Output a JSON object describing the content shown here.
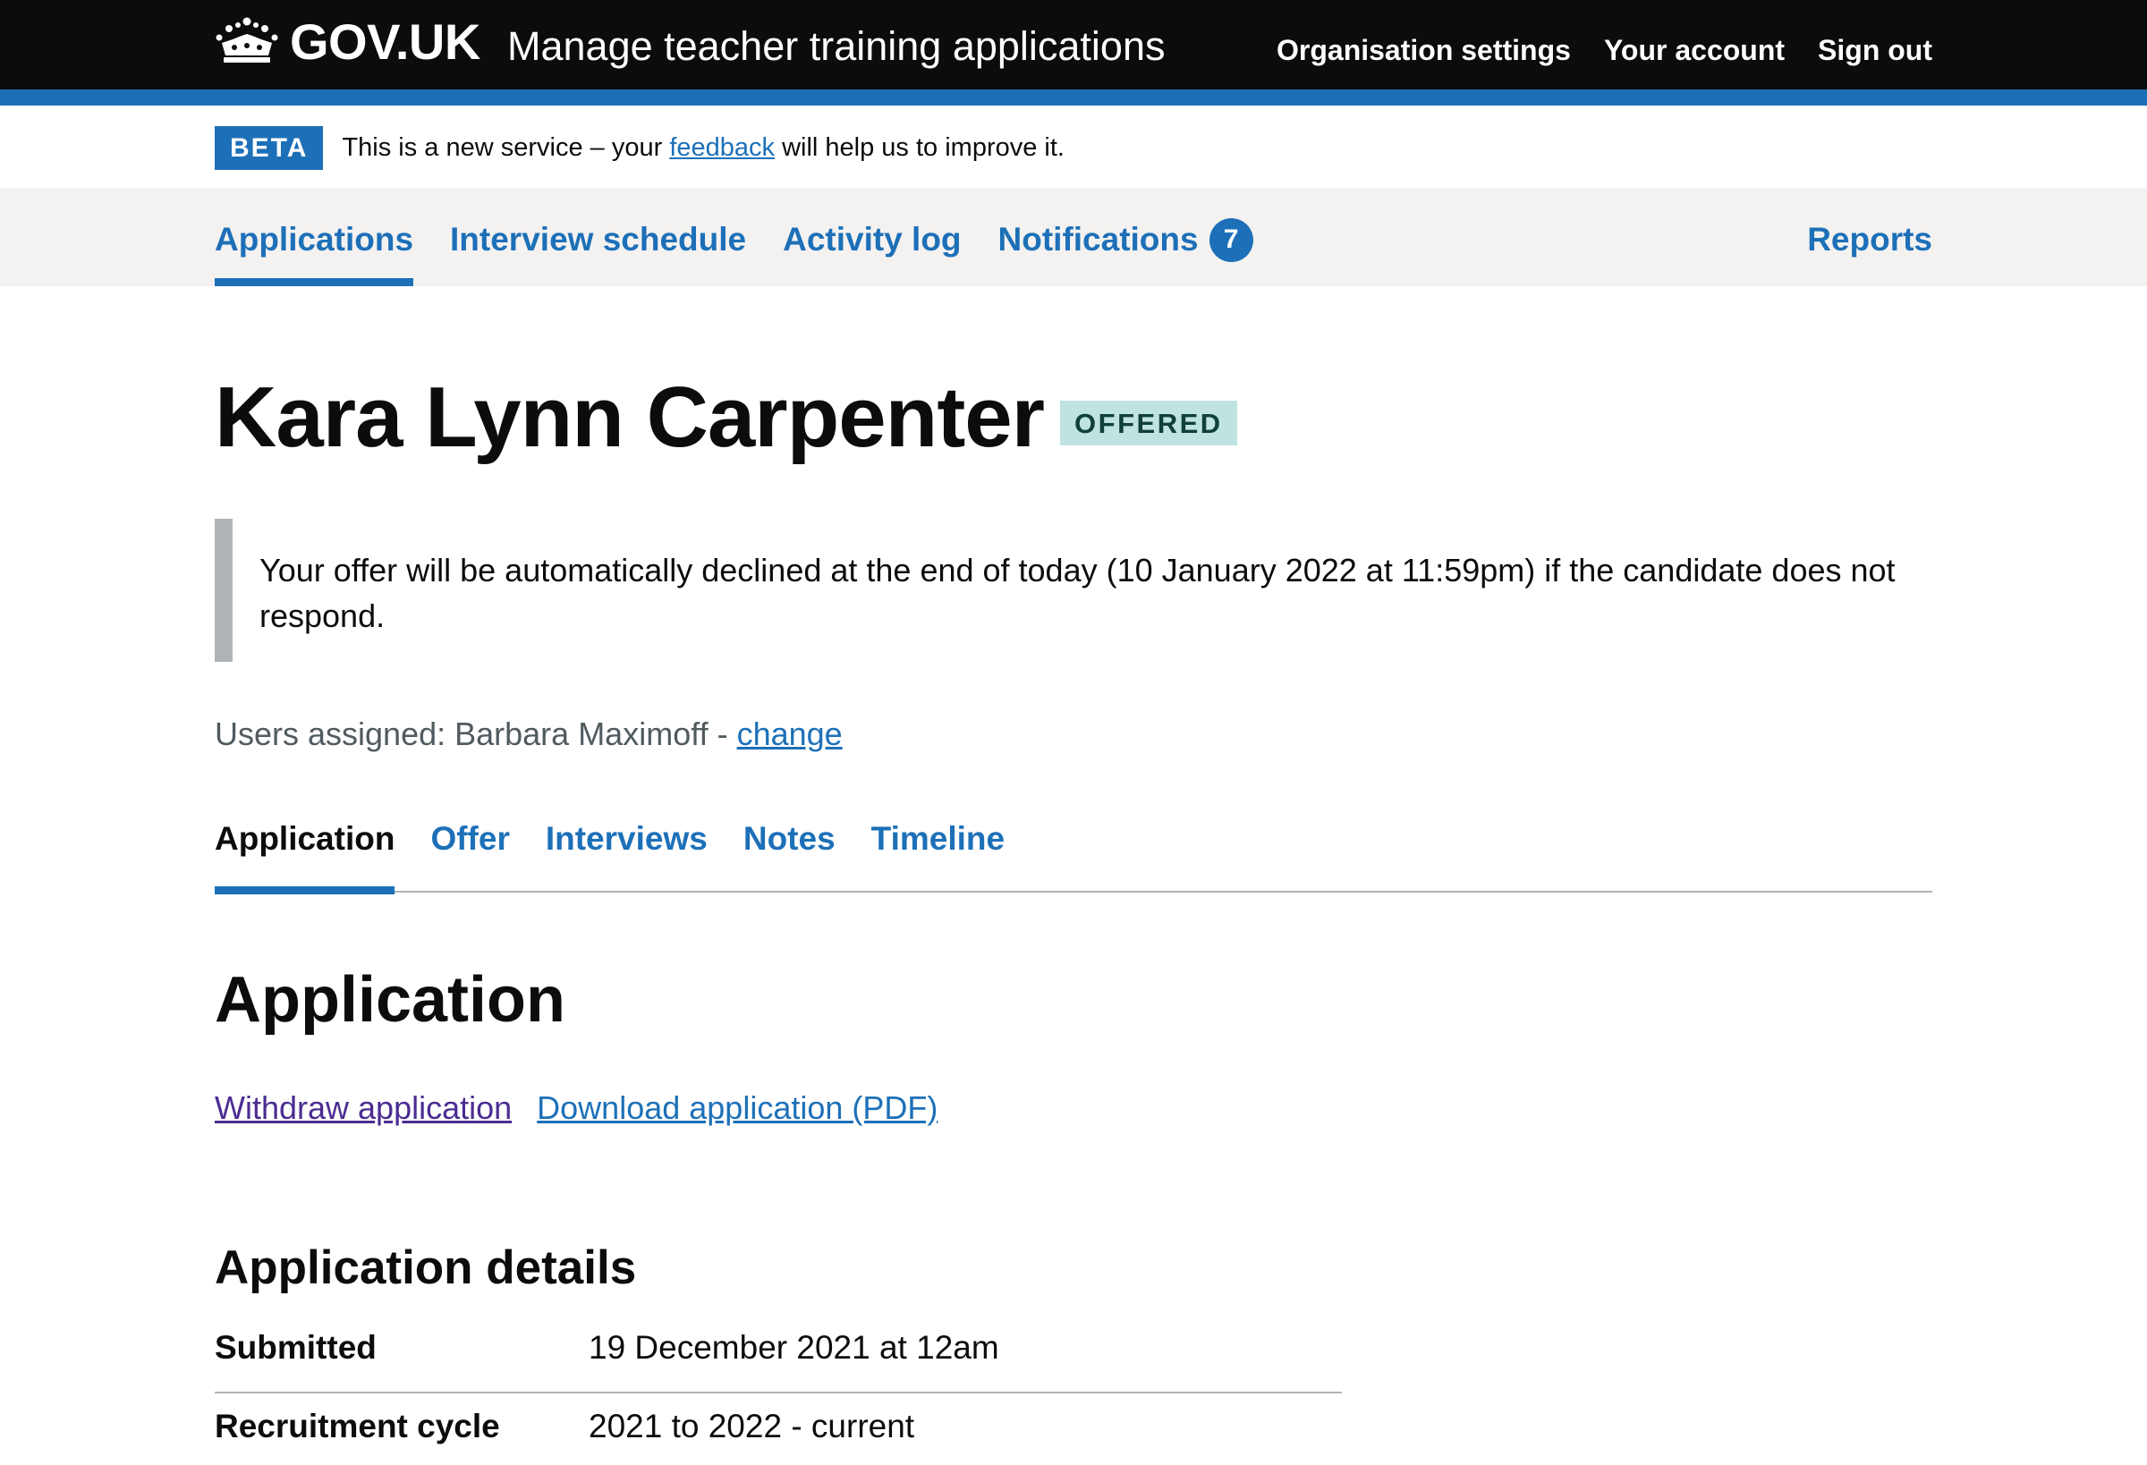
{
  "header": {
    "logo_text": "GOV.UK",
    "service_name": "Manage teacher training applications",
    "nav": [
      "Organisation settings",
      "Your account",
      "Sign out"
    ]
  },
  "phase_banner": {
    "tag": "BETA",
    "text_before": "This is a new service – your ",
    "link": "feedback",
    "text_after": " will help us to improve it."
  },
  "primary_nav": {
    "items": [
      "Applications",
      "Interview schedule",
      "Activity log",
      "Notifications"
    ],
    "notification_count": "7",
    "active": "Applications",
    "right": "Reports"
  },
  "candidate": {
    "name": "Kara Lynn Carpenter",
    "status": "OFFERED"
  },
  "inset_text": "Your offer will be automatically declined at the end of today (10 January 2022 at 11:59pm) if the candidate does not respond.",
  "assigned": {
    "label": "Users assigned: Barbara Maximoff - ",
    "link": "change"
  },
  "sub_nav": {
    "items": [
      "Application",
      "Offer",
      "Interviews",
      "Notes",
      "Timeline"
    ],
    "active": "Application"
  },
  "section_title": "Application",
  "actions": {
    "withdraw": "Withdraw application",
    "download": "Download application (PDF)"
  },
  "details": {
    "title": "Application details",
    "rows": [
      {
        "key": "Submitted",
        "value": "19 December 2021 at 12am"
      },
      {
        "key": "Recruitment cycle",
        "value": "2021 to 2022 - current"
      }
    ]
  },
  "colors": {
    "brand_blue": "#1d70b8",
    "header_black": "#0b0c0c",
    "status_tag_bg": "#bfe3e0",
    "visited_link": "#4c2c92"
  }
}
